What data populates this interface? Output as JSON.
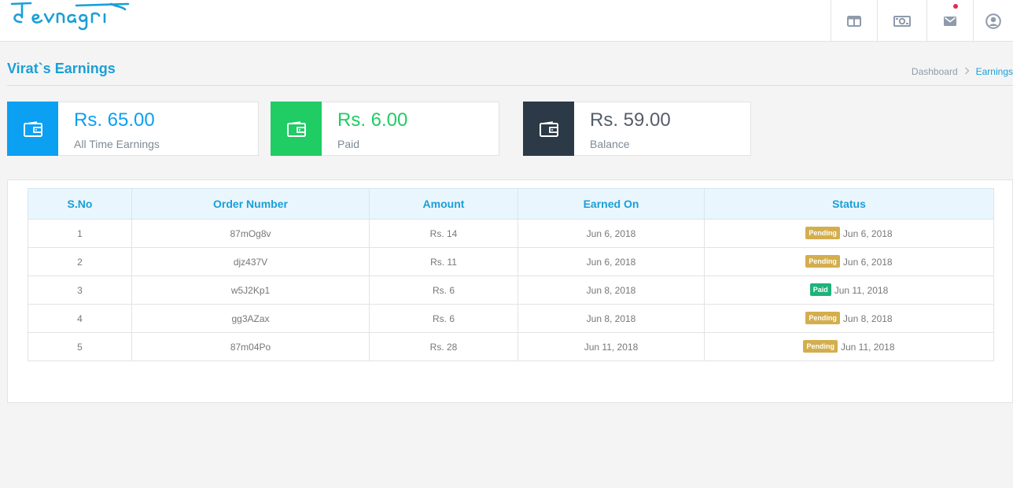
{
  "brand": {
    "logo_text": "devnagri",
    "accent_color": "#1a9fd8"
  },
  "topbar": {
    "icons": [
      {
        "name": "layout-icon"
      },
      {
        "name": "money-icon"
      },
      {
        "name": "mail-icon",
        "has_notification": true
      },
      {
        "name": "user-profile-icon"
      }
    ]
  },
  "page": {
    "title": "Virat`s Earnings"
  },
  "breadcrumb": {
    "home": "Dashboard",
    "current": "Earnings"
  },
  "stats": [
    {
      "value": "Rs. 65.00",
      "label": "All Time Earnings",
      "color": "#0ba0f2",
      "icon": "wallet-icon"
    },
    {
      "value": "Rs. 6.00",
      "label": "Paid",
      "color": "#20cc64",
      "icon": "wallet-icon"
    },
    {
      "value": "Rs. 59.00",
      "label": "Balance",
      "color": "#2c3a47",
      "icon": "wallet-icon"
    }
  ],
  "table": {
    "headers": [
      "S.No",
      "Order Number",
      "Amount",
      "Earned On",
      "Status"
    ],
    "rows": [
      {
        "sno": "1",
        "order": "87mOg8v",
        "amount": "Rs. 14",
        "earned": "Jun 6, 2018",
        "status": "Pending",
        "status_date": "Jun 6, 2018"
      },
      {
        "sno": "2",
        "order": "djz437V",
        "amount": "Rs. 11",
        "earned": "Jun 6, 2018",
        "status": "Pending",
        "status_date": "Jun 6, 2018"
      },
      {
        "sno": "3",
        "order": "w5J2Kp1",
        "amount": "Rs. 6",
        "earned": "Jun 8, 2018",
        "status": "Paid",
        "status_date": "Jun 11, 2018"
      },
      {
        "sno": "4",
        "order": "gg3AZax",
        "amount": "Rs. 6",
        "earned": "Jun 8, 2018",
        "status": "Pending",
        "status_date": "Jun 8, 2018"
      },
      {
        "sno": "5",
        "order": "87m04Po",
        "amount": "Rs. 28",
        "earned": "Jun 11, 2018",
        "status": "Pending",
        "status_date": "Jun 11, 2018"
      }
    ]
  }
}
